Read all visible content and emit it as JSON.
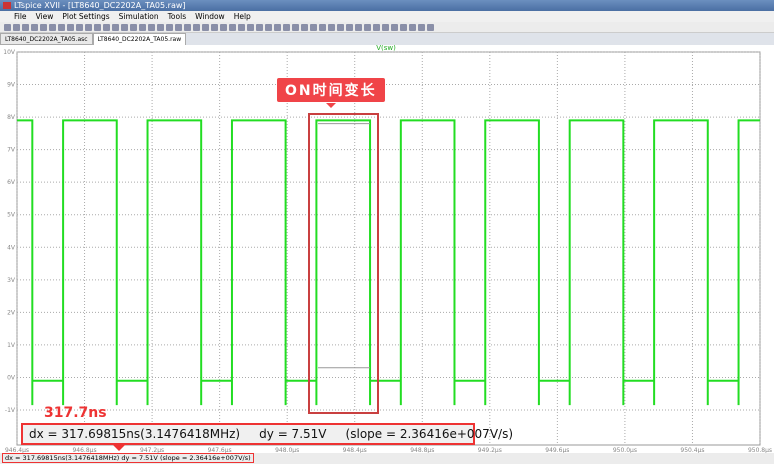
{
  "window": {
    "title": "LTspice XVII - [LT8640_DC2202A_TA05.raw]"
  },
  "menu": [
    "File",
    "View",
    "Plot Settings",
    "Simulation",
    "Tools",
    "Window",
    "Help"
  ],
  "tabs": [
    {
      "label": "LT8640_DC2202A_TA05.asc",
      "active": false
    },
    {
      "label": "LT8640_DC2202A_TA05.raw",
      "active": true
    }
  ],
  "annotations": {
    "on_label": "ON时间变长",
    "dx_label": "317.7ns",
    "accent": "#f04448"
  },
  "readout": "dx = 317.69815ns(3.1476418MHz)     dy = 7.51V     (slope = 2.36416e+007V/s)",
  "status": "dx = 317.69815ns(3.1476418MHz)    dy = 7.51V    (slope = 2.36416e+007V/s)",
  "chart_data": {
    "type": "line",
    "trace_label": "V(sw)",
    "color": "#22dd22",
    "xlim": [
      946.4,
      950.8
    ],
    "ylim": [
      -1,
      10
    ],
    "xticks": [
      "946.4µs",
      "946.8µs",
      "947.2µs",
      "947.6µs",
      "948.0µs",
      "948.4µs",
      "948.8µs",
      "949.2µs",
      "949.6µs",
      "950.0µs",
      "950.4µs",
      "950.8µs"
    ],
    "xtick_values": [
      946.4,
      946.8,
      947.2,
      947.6,
      948.0,
      948.4,
      948.8,
      949.2,
      949.6,
      950.0,
      950.4,
      950.8
    ],
    "yticks": [
      "-1V",
      "0V",
      "1V",
      "2V",
      "3V",
      "4V",
      "5V",
      "6V",
      "7V",
      "8V",
      "9V",
      "10V"
    ],
    "ytick_values": [
      -1,
      0,
      1,
      2,
      3,
      4,
      5,
      6,
      7,
      8,
      9,
      10
    ],
    "grid": true,
    "rising_edges_us": [
      946.673,
      947.173,
      947.673,
      948.173,
      948.673,
      949.173,
      949.673,
      950.173,
      950.673
    ],
    "on_time_ns": 317.7,
    "high_v": 7.9,
    "low_v": -0.1,
    "spike_v": -0.85,
    "cursor_levels_v": [
      7.8,
      0.3
    ]
  }
}
